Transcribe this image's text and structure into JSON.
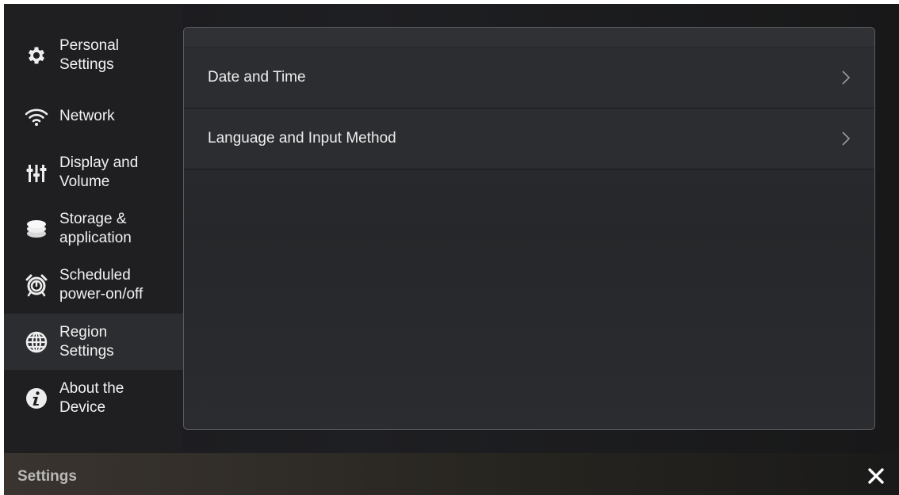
{
  "sidebar": {
    "items": [
      {
        "label": "Personal\nSettings",
        "icon": "gear-icon",
        "active": false
      },
      {
        "label": "Network",
        "icon": "wifi-icon",
        "active": false
      },
      {
        "label": "Display and\nVolume",
        "icon": "sliders-icon",
        "active": false
      },
      {
        "label": "Storage &\napplication",
        "icon": "storage-icon",
        "active": false
      },
      {
        "label": "Scheduled\npower-on/off",
        "icon": "alarm-clock-icon",
        "active": false
      },
      {
        "label": "Region\nSettings",
        "icon": "globe-icon",
        "active": true
      },
      {
        "label": "About the\nDevice",
        "icon": "info-icon",
        "active": false
      }
    ]
  },
  "main": {
    "rows": [
      {
        "label": "Date and Time",
        "icon": "chevron-right-icon"
      },
      {
        "label": "Language and Input Method",
        "icon": "chevron-right-icon"
      }
    ]
  },
  "footer": {
    "title": "Settings",
    "close_icon": "close-icon"
  },
  "colors": {
    "active_item_bg": "#2c2d31",
    "panel_border": "#5a5c60",
    "text_primary": "#f2f2f2",
    "text_footer": "#b9b9b9"
  }
}
